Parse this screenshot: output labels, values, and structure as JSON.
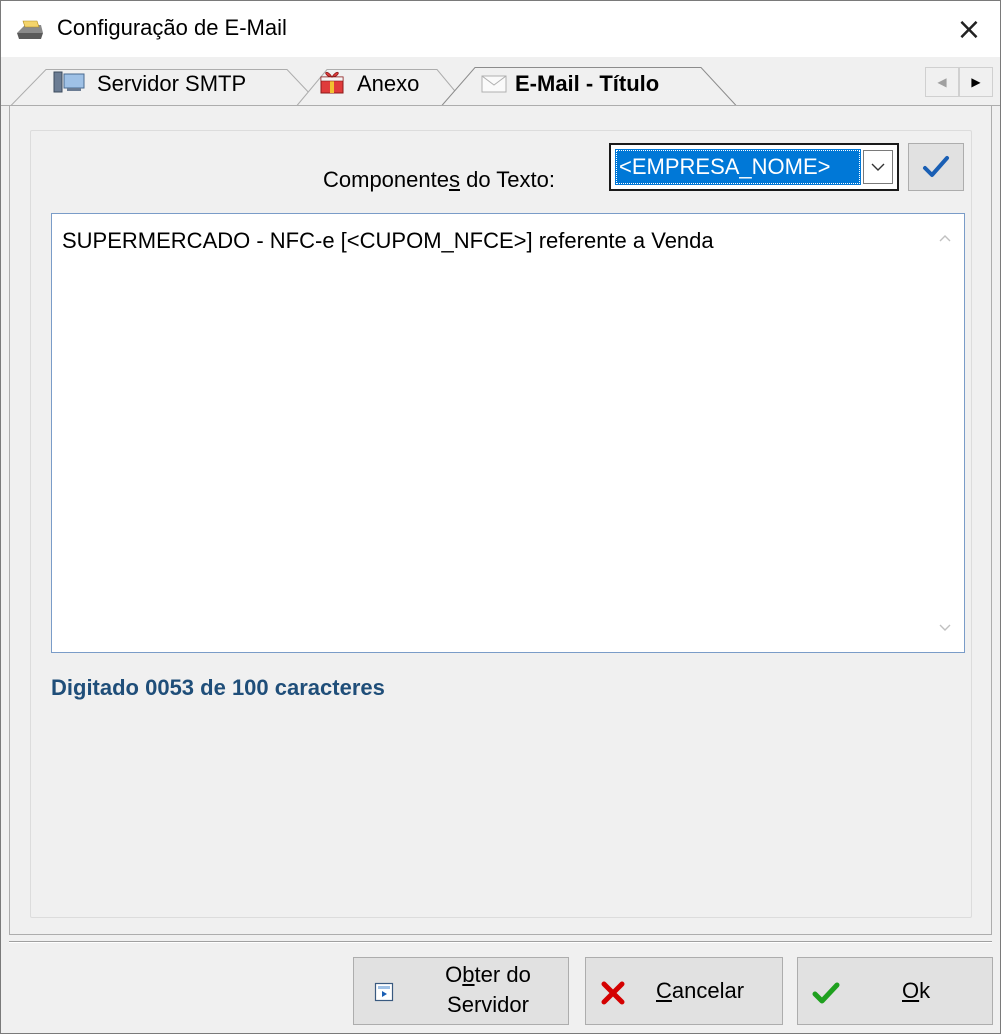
{
  "window": {
    "title": "Configuração de E-Mail",
    "close_glyph": "×"
  },
  "tabs": [
    {
      "label": "Servidor SMTP",
      "icon": "server-icon",
      "active": false
    },
    {
      "label": "Anexo",
      "icon": "gift-icon",
      "active": false
    },
    {
      "label": "E-Mail - Título",
      "icon": "envelope-icon",
      "active": true
    }
  ],
  "tab_scroll": {
    "left_glyph": "◀",
    "right_glyph": "▶"
  },
  "components": {
    "label_pre": "Componente",
    "label_mnemonic": "s",
    "label_post": " do Texto:",
    "selected_value": "<EMPRESA_NOME>"
  },
  "editor": {
    "value": "SUPERMERCADO - NFC-e [<CUPOM_NFCE>] referente a Venda"
  },
  "counter_text": "Digitado 0053 de 100 caracteres",
  "buttons": {
    "obter_line1_pre": "O",
    "obter_line1_mn": "b",
    "obter_line1_post": "ter do",
    "obter_line2": "Servidor",
    "cancelar_mn": "C",
    "cancelar_rest": "ancelar",
    "ok_mn": "O",
    "ok_rest": "k"
  },
  "colors": {
    "accent": "#0078d7",
    "counter": "#1f4e79",
    "cancel_x": "#d40000",
    "ok_check": "#1fa01f",
    "check_blue": "#1a5fb4"
  }
}
